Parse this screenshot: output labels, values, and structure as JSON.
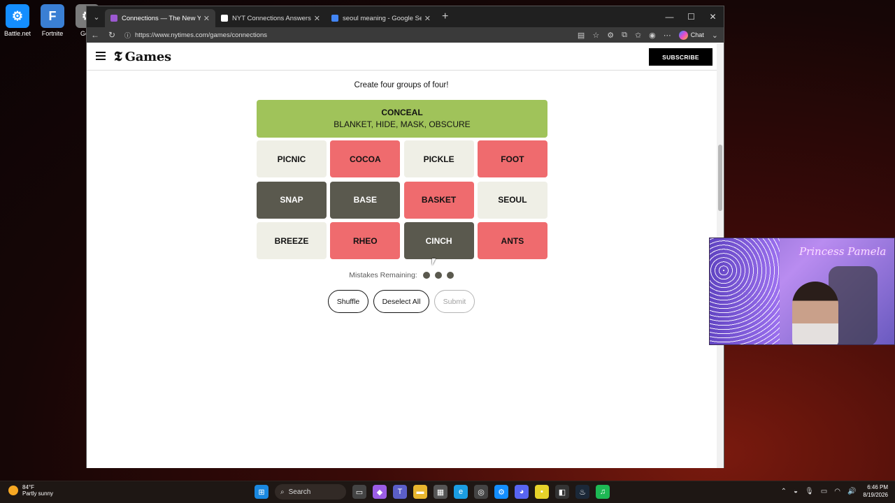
{
  "desktop": {
    "icons": [
      {
        "label": "Battle.net",
        "color": "#148eff",
        "glyph": "⚙"
      },
      {
        "label": "Fortnite",
        "color": "#3a7fd4",
        "glyph": "F"
      },
      {
        "label": "Gear",
        "color": "#7a7a7a",
        "glyph": "⚙"
      }
    ]
  },
  "browser": {
    "tabs": [
      {
        "title": "Connections — The New York Times",
        "favicon_color": "#9c59d1",
        "active": true
      },
      {
        "title": "NYT Connections Answers for Aug",
        "favicon_color": "#ffffff",
        "active": false
      },
      {
        "title": "seoul meaning - Google Search",
        "favicon_color": "#4285f4",
        "active": false
      }
    ],
    "new_tab_glyph": "+",
    "url": "https://www.nytimes.com/games/connections",
    "chat_label": "Chat"
  },
  "nyt": {
    "logo_t": "𝕿",
    "logo_games": "Games",
    "subscribe_label": "SUBSCRIBE"
  },
  "game": {
    "instructions": "Create four groups of four!",
    "solved_groups": [
      {
        "category": "CONCEAL",
        "members": "BLANKET, HIDE, MASK, OBSCURE",
        "color": "#a0c35a"
      }
    ],
    "cards": [
      {
        "word": "PICNIC",
        "state": "light"
      },
      {
        "word": "COCOA",
        "state": "red"
      },
      {
        "word": "PICKLE",
        "state": "light"
      },
      {
        "word": "FOOT",
        "state": "red"
      },
      {
        "word": "SNAP",
        "state": "dark"
      },
      {
        "word": "BASE",
        "state": "dark"
      },
      {
        "word": "BASKET",
        "state": "red"
      },
      {
        "word": "SEOUL",
        "state": "light"
      },
      {
        "word": "BREEZE",
        "state": "light"
      },
      {
        "word": "RHEO",
        "state": "red"
      },
      {
        "word": "CINCH",
        "state": "dark"
      },
      {
        "word": "ANTS",
        "state": "red"
      }
    ],
    "mistakes_label": "Mistakes Remaining:",
    "mistakes_remaining": 3,
    "buttons": {
      "shuffle": "Shuffle",
      "deselect": "Deselect All",
      "submit": "Submit"
    }
  },
  "webcam": {
    "overlay_name": "Princess Pamela"
  },
  "taskbar": {
    "weather_temp": "84°F",
    "weather_desc": "Partly sunny",
    "search_label": "Search",
    "time": "6:46 PM",
    "date": "8/19/2026"
  }
}
